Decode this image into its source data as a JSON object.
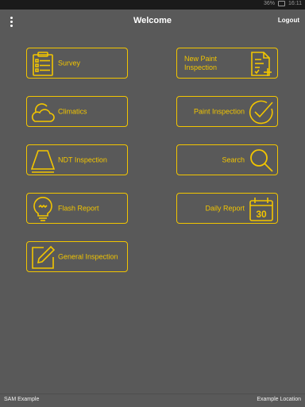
{
  "statusbar": {
    "time": "16:11",
    "signal": "36%"
  },
  "header": {
    "title": "Welcome",
    "logout_label": "Logout"
  },
  "tiles": {
    "survey": {
      "label": "Survey",
      "icon": "clipboard-list-icon"
    },
    "new_paint_inspection": {
      "label": "New Paint\nInspection",
      "icon": "document-plus-icon"
    },
    "climatics": {
      "label": "Climatics",
      "icon": "sun-cloud-icon"
    },
    "paint_inspection": {
      "label": "Paint Inspection",
      "icon": "check-circle-icon"
    },
    "ndt_inspection": {
      "label": "NDT Inspection",
      "icon": "lamp-icon"
    },
    "search": {
      "label": "Search",
      "icon": "search-icon"
    },
    "flash_report": {
      "label": "Flash Report",
      "icon": "lightbulb-icon"
    },
    "daily_report": {
      "label": "Daily Report",
      "icon": "calendar-icon",
      "calendar_day": "30"
    },
    "general_inspection": {
      "label": "General Inspection",
      "icon": "pencil-square-icon"
    }
  },
  "footer": {
    "user": "SAM Example",
    "location": "Example Location"
  },
  "colors": {
    "background": "#595959",
    "accent": "#f2c500"
  }
}
